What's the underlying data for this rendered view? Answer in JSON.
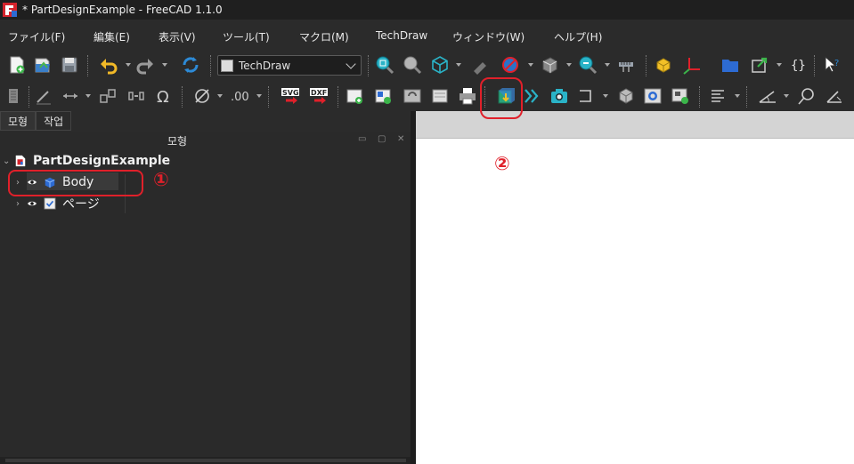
{
  "window": {
    "title": "* PartDesignExample - FreeCAD 1.1.0"
  },
  "menu": [
    {
      "label": "ファイル(F)"
    },
    {
      "label": "編集(E)"
    },
    {
      "label": "表示(V)"
    },
    {
      "label": "ツール(T)"
    },
    {
      "label": "マクロ(M)"
    },
    {
      "label": "TechDraw"
    },
    {
      "label": "ウィンドウ(W)"
    },
    {
      "label": "ヘルプ(H)"
    }
  ],
  "toolbar": {
    "workbench_selected": "TechDraw",
    "icons_row1": [
      "new-document-icon",
      "open-document-icon",
      "save-icon",
      "undo-icon",
      "redo-icon",
      "refresh-icon",
      "workbench-selector",
      "fit-all-icon",
      "fit-selection-icon",
      "isometric-view-icon",
      "draw-style-icon",
      "sync-view-icon",
      "std-views-icon",
      "zoom-icon",
      "measure-icon",
      "part-icon",
      "axis-icon",
      "group-icon",
      "link-icon",
      "expression-icon",
      "whats-this-icon"
    ],
    "icons_row2": [
      "dimension-icon",
      "line-style-icon",
      "leader-icon",
      "balloon-icon",
      "weld-icon",
      "omega-icon",
      "diameter-icon",
      "hole-shaft-fit-icon",
      "export-svg-icon",
      "export-dxf-icon",
      "insert-page-icon",
      "insert-template-page-icon",
      "redraw-icon",
      "print-icon",
      "insert-view-icon",
      "projection-group-icon",
      "active-view-icon",
      "section-icon",
      "detail-view-icon",
      "clip-icon",
      "symbol-icon",
      "annotation-icon",
      "centerline-icon",
      "angle-dimension-icon",
      "radius-icon",
      "length-icon"
    ],
    "svg_label": "SVG",
    "dxf_label": "DXF"
  },
  "tabs": [
    {
      "label": "모형"
    },
    {
      "label": "작업"
    }
  ],
  "panel": {
    "title": "모형"
  },
  "tree": {
    "root": {
      "label": "PartDesignExample"
    },
    "items": [
      {
        "label": "Body"
      },
      {
        "label": "ページ"
      }
    ]
  },
  "annotations": [
    {
      "label": "①"
    },
    {
      "label": "②"
    }
  ],
  "colors": {
    "annotation": "#e0202a",
    "background": "#2b2b2b",
    "view": "#ffffff"
  }
}
